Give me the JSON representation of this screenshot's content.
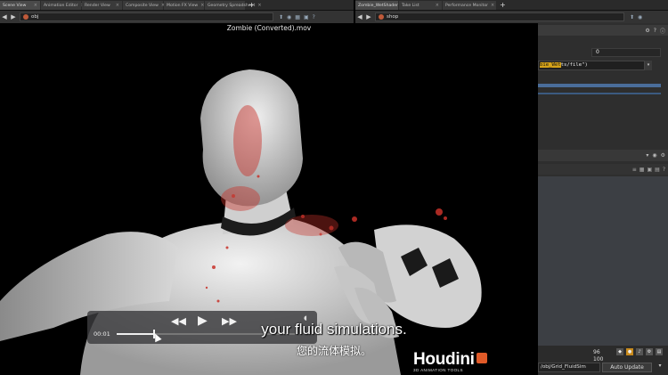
{
  "left_tabs": [
    "Scene View",
    "Animation Editor",
    "Render View",
    "Composite View",
    "Motion FX View",
    "Geometry Spreadsheet"
  ],
  "right_tabs": [
    "Zombie_WetShader",
    "Take List",
    "Performance Monitor"
  ],
  "left_path": "obj",
  "right_path": "shop",
  "video_title": "Zombie (Converted).mov",
  "parm_value": "0",
  "parm_expr_pre": "",
  "parm_expr_hl": "bie_Wet",
  "parm_expr_post": "ts/file\")",
  "timeline_frame": "96",
  "timeline_end": "100",
  "node_path": "/obj/Grid_FluidSim",
  "auto_update": "Auto Update",
  "player": {
    "time": "00:01",
    "progress": 0.21
  },
  "subtitle_en": "your fluid simulations.",
  "subtitle_zh": "您的流体模拟。",
  "logo": {
    "word": "Houdini",
    "sub": "3D ANIMATION TOOLS"
  },
  "colors": {
    "accent_orange": "#e05a28",
    "highlight": "#d6a319",
    "pane_bg": "#2e2e2e"
  }
}
